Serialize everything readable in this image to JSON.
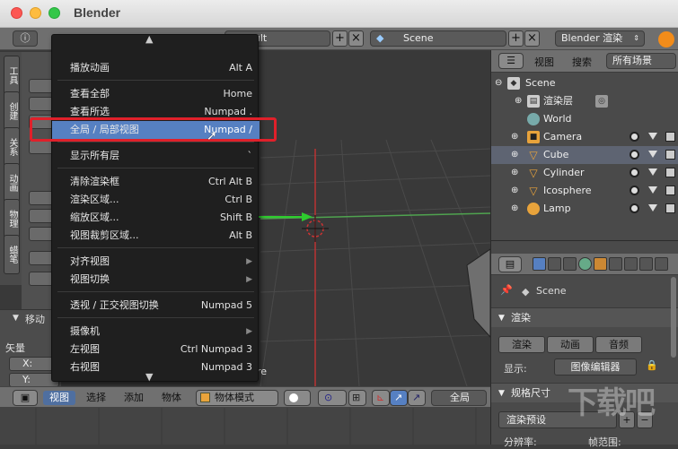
{
  "window": {
    "title": "Blender"
  },
  "topbar": {
    "layout_label": "Default",
    "scene_label": "Scene",
    "engine_label": "Blender 渲染"
  },
  "tool_tabs": [
    "工具",
    "创建",
    "关系",
    "动画",
    "物理",
    "蜡笔"
  ],
  "menu": {
    "items": [
      {
        "label": "播放动画",
        "shortcut": "Alt A"
      },
      {
        "label": "查看全部",
        "shortcut": "Home"
      },
      {
        "label": "查看所选",
        "shortcut": "Numpad ."
      },
      {
        "label": "全局 / 局部视图",
        "shortcut": "Numpad /"
      },
      {
        "label": "显示所有层",
        "shortcut": "`"
      },
      {
        "label": "清除渲染框",
        "shortcut": "Ctrl Alt B"
      },
      {
        "label": "渲染区域...",
        "shortcut": "Ctrl B"
      },
      {
        "label": "缩放区域...",
        "shortcut": "Shift B"
      },
      {
        "label": "视图裁剪区域...",
        "shortcut": "Alt B"
      },
      {
        "label": "对齐视图",
        "shortcut": ""
      },
      {
        "label": "视图切换",
        "shortcut": ""
      },
      {
        "label": "透视 / 正交视图切换",
        "shortcut": "Numpad 5"
      },
      {
        "label": "摄像机",
        "shortcut": ""
      },
      {
        "label": "左视图",
        "shortcut": "Ctrl Numpad 3"
      },
      {
        "label": "右视图",
        "shortcut": "Numpad 3"
      }
    ]
  },
  "left_panel": {
    "header": "移动",
    "vector_label": "矢量",
    "x_label": "X:",
    "y_label": "Y:"
  },
  "bottombar": {
    "view": "视图",
    "select": "选择",
    "add": "添加",
    "object": "物体",
    "mode": "物体模式",
    "global": "全局"
  },
  "viewport": {
    "text_fragment": "re"
  },
  "outliner": {
    "view": "视图",
    "search": "搜索",
    "filter": "所有场景",
    "rows": [
      {
        "label": "Scene"
      },
      {
        "label": "渲染层"
      },
      {
        "label": "World"
      },
      {
        "label": "Camera"
      },
      {
        "label": "Cube"
      },
      {
        "label": "Cylinder"
      },
      {
        "label": "Icosphere"
      },
      {
        "label": "Lamp"
      }
    ]
  },
  "properties": {
    "scene": "Scene",
    "render_section": "渲染",
    "render_btn": "渲染",
    "anim_btn": "动画",
    "audio_btn": "音频",
    "display_label": "显示:",
    "display_value": "图像编辑器",
    "dims_section": "规格尺寸",
    "preset": "渲染预设",
    "resolution": "分辨率:",
    "frame_range": "帧范围:"
  },
  "watermark": "下载吧"
}
